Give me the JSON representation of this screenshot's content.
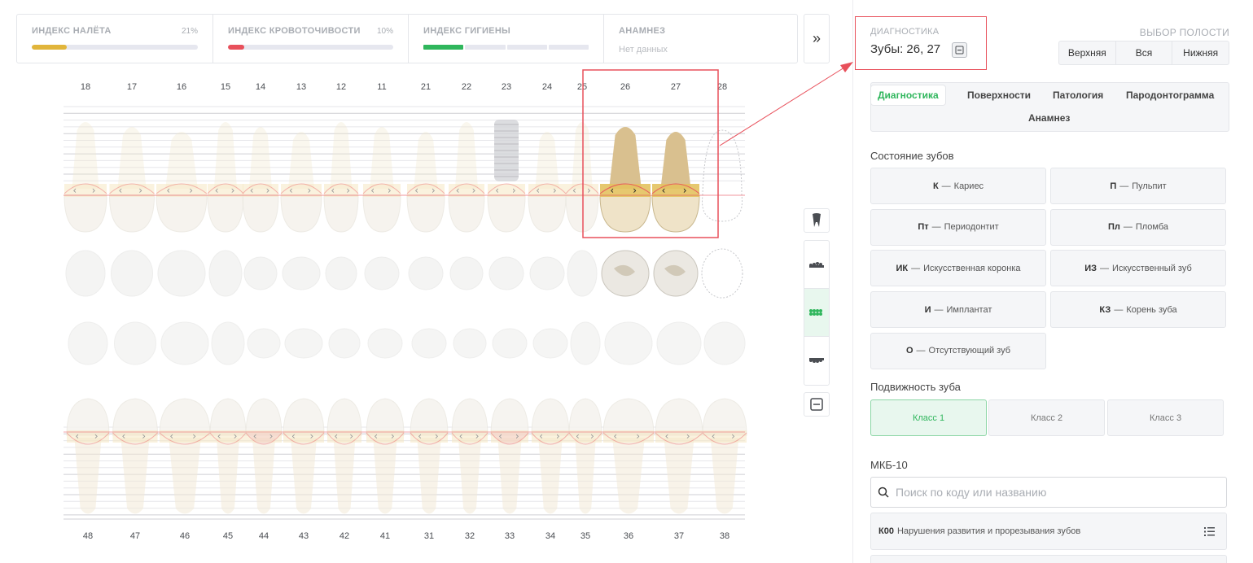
{
  "indices": [
    {
      "title": "ИНДЕКС НАЛЁТА",
      "percent": "21%",
      "value": 0.21,
      "color": "#e1b53b"
    },
    {
      "title": "ИНДЕКС КРОВОТОЧИВОСТИ",
      "percent": "10%",
      "value": 0.1,
      "color": "#e8505b"
    },
    {
      "title": "ИНДЕКС ГИГИЕНЫ",
      "segments_filled": 1,
      "segments_total": 4,
      "color": "#2fb65c"
    },
    {
      "title": "АНАМНЕЗ",
      "subtitle": "Нет данных"
    }
  ],
  "expand_icon": "»",
  "upper_teeth": [
    "18",
    "17",
    "16",
    "15",
    "14",
    "13",
    "12",
    "11",
    "21",
    "22",
    "23",
    "24",
    "25",
    "26",
    "27",
    "28"
  ],
  "lower_teeth": [
    "48",
    "47",
    "46",
    "45",
    "44",
    "43",
    "42",
    "41",
    "31",
    "32",
    "33",
    "34",
    "35",
    "36",
    "37",
    "38"
  ],
  "selected_teeth": [
    "26",
    "27"
  ],
  "implant_tooth": "23",
  "missing_tooth": "28",
  "diagnostics": {
    "label": "ДИАГНОСТИКА",
    "teeth": "Зубы: 26, 27"
  },
  "jaw": {
    "label": "ВЫБОР ПОЛОСТИ",
    "options": [
      "Верхняя",
      "Вся",
      "Нижняя"
    ]
  },
  "tabs": [
    "Диагностика",
    "Поверхности",
    "Патология",
    "Пародонтограмма",
    "Анамнез"
  ],
  "active_tab": "Диагностика",
  "conditions_title": "Состояние зубов",
  "conditions": [
    {
      "code": "К",
      "label": "Кариес"
    },
    {
      "code": "П",
      "label": "Пульпит"
    },
    {
      "code": "Пт",
      "label": "Периодонтит"
    },
    {
      "code": "Пл",
      "label": "Пломба"
    },
    {
      "code": "ИК",
      "label": "Искусственная коронка"
    },
    {
      "code": "ИЗ",
      "label": "Искусственный зуб"
    },
    {
      "code": "И",
      "label": "Имплантат"
    },
    {
      "code": "КЗ",
      "label": "Корень зуба"
    },
    {
      "code": "О",
      "label": "Отсутствующий зуб"
    }
  ],
  "dash": "—",
  "mobility_title": "Подвижность зуба",
  "mobility": [
    "Класс 1",
    "Класс 2",
    "Класс 3"
  ],
  "mobility_active": "Класс 1",
  "mkb": {
    "title": "МКБ-10",
    "search_placeholder": "Поиск по коду или названию",
    "items": [
      {
        "code": "К00",
        "label": "Нарушения развития и прорезывания зубов"
      }
    ]
  },
  "colors": {
    "accent": "#2fb65c",
    "highlight": "#e8505b",
    "plaque": "#e1b53b"
  }
}
